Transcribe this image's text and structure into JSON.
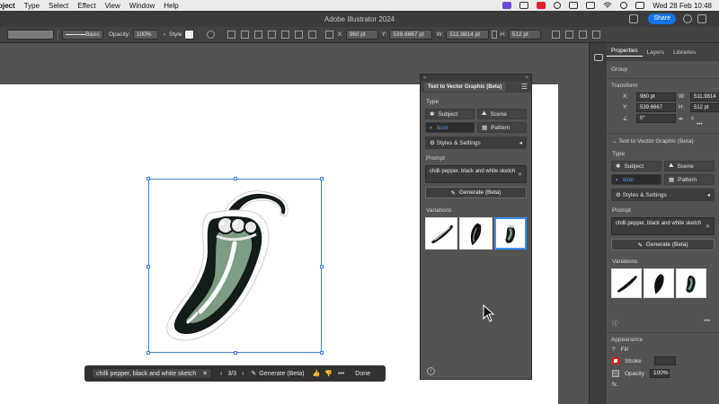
{
  "menubar": {
    "items": [
      "bject",
      "Type",
      "Select",
      "Effect",
      "View",
      "Window",
      "Help"
    ],
    "clock": "Wed 28 Feb  10:48"
  },
  "app": {
    "title": "Adobe Illustrator 2024",
    "share_label": "Share"
  },
  "controlbar": {
    "stroke_style": "Basic",
    "opacity_label": "Opacity:",
    "opacity_value": "100%",
    "style_label": "Style",
    "x_label": "X:",
    "x_value": "960 pt",
    "y_label": "Y:",
    "y_value": "539.6667 pt",
    "w_label": "W:",
    "w_value": "511.9814 pt",
    "h_label": "H:",
    "h_value": "512 pt"
  },
  "taskbar": {
    "prompt": "chilli pepper, black and white sketch",
    "page": "3/3",
    "generate_label": "Generate (Beta)",
    "done_label": "Done"
  },
  "float_panel": {
    "tab_title": "Text to Vector Graphic (Beta)",
    "type_label": "Type",
    "types": [
      "Subject",
      "Scene",
      "Icon",
      "Pattern"
    ],
    "selected_type": "Icon",
    "styles_label": "Styles & Settings",
    "prompt_label": "Prompt",
    "prompt_value": "chilli pepper, black and white sketch",
    "generate_label": "Generate (Beta)",
    "variations_label": "Variations"
  },
  "properties": {
    "tabs": [
      "Properties",
      "Layers",
      "Libraries"
    ],
    "active_tab": "Properties",
    "group_label": "Group",
    "transform_label": "Transform",
    "x_label": "X:",
    "x_value": "960 pt",
    "y_label": "Y:",
    "y_value": "539.6667",
    "w_label": "W:",
    "w_value": "511.9814",
    "h_label": "H:",
    "h_value": "512 pt",
    "angle_value": "0°",
    "ttv_section": "Text to Vector Graphic (Beta)",
    "type_label": "Type",
    "types": [
      "Subject",
      "Scene",
      "Icon",
      "Pattern"
    ],
    "styles_label": "Styles & Settings",
    "prompt_label": "Prompt",
    "prompt_value": "chilli pepper, black and white sketch",
    "generate_label": "Generate (Beta)",
    "variations_label": "Variations",
    "appearance_label": "Appearance",
    "fill_label": "Fill",
    "stroke_label": "Stroke",
    "opacity_label": "Opacity",
    "opacity_value": "100%",
    "fx_label": "fx."
  },
  "colors": {
    "accent": "#1473e6",
    "selection": "#4a7fd6",
    "pepper_green": "#7e9b84",
    "pepper_dark": "#141c1a"
  }
}
